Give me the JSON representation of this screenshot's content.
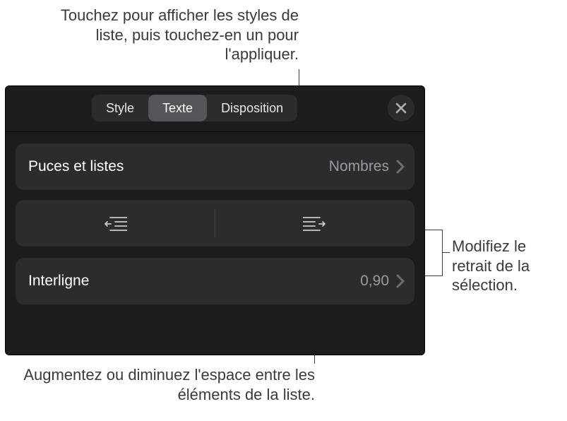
{
  "callouts": {
    "top": "Touchez pour afficher les styles de liste, puis touchez-en un pour l'appliquer.",
    "right": "Modifiez le retrait de la sélection.",
    "bottom": "Augmentez ou diminuez l'espace entre les éléments de la liste."
  },
  "panel": {
    "tabs": {
      "style": "Style",
      "texte": "Texte",
      "disposition": "Disposition"
    },
    "bullets_row": {
      "label": "Puces et listes",
      "value": "Nombres"
    },
    "indent": {
      "decrease": "indent-decrease",
      "increase": "indent-increase"
    },
    "spacing_row": {
      "label": "Interligne",
      "value": "0,90"
    },
    "colors": {
      "panel_bg": "#1c1c1e",
      "row_bg": "#2c2c2e",
      "seg_active": "#555559",
      "secondary_text": "#9a9aa0"
    }
  }
}
